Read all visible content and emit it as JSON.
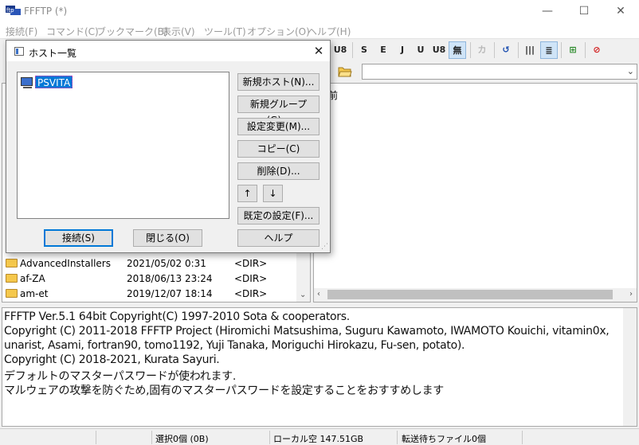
{
  "window": {
    "title": "FFFTP (*)"
  },
  "window_controls": {
    "minimize": "—",
    "maximize": "☐",
    "close": "✕"
  },
  "menu": [
    "接続(F)",
    "コマンド(C)",
    "ブックマーク(B)",
    "表示(V)",
    "ツール(T)",
    "オプション(O)",
    "ヘルプ(H)"
  ],
  "toolbar": {
    "buttons": [
      "U8",
      "S",
      "E",
      "J",
      "U",
      "U8",
      "無",
      "カ",
      "↺",
      "|||",
      "≣",
      "⊞",
      "⊘"
    ]
  },
  "right_pane": {
    "header_fragment": "前"
  },
  "left_files": [
    {
      "name": "AdvancedInstallers",
      "date": "2021/05/02  0:31",
      "size": "<DIR>"
    },
    {
      "name": "af-ZA",
      "date": "2018/06/13 23:24",
      "size": "<DIR>"
    },
    {
      "name": "am-et",
      "date": "2019/12/07 18:14",
      "size": "<DIR>"
    }
  ],
  "log": [
    "FFFTP Ver.5.1 64bit Copyright(C) 1997-2010 Sota & cooperators.",
    "Copyright (C) 2011-2018 FFFTP Project (Hiromichi Matsushima, Suguru Kawamoto, IWAMOTO Kouichi, vitamin0x,",
    "unarist, Asami, fortran90, tomo1192, Yuji Tanaka, Moriguchi Hirokazu, Fu-sen, potato).",
    "Copyright (C) 2018-2021, Kurata Sayuri.",
    "デフォルトのマスターパスワードが使われます.",
    "マルウェアの攻撃を防ぐため,固有のマスターパスワードを設定することをおすすめします"
  ],
  "status": {
    "selected": "選択0個 (0B)",
    "local_free": "ローカル空 147.51GB",
    "queue": "転送待ちファイル0個"
  },
  "dialog": {
    "title": "ホスト一覧",
    "hosts": [
      "PSVITA"
    ],
    "buttons": {
      "new_host": "新規ホスト(N)...",
      "new_group": "新規グループ(G)...",
      "edit": "設定変更(M)...",
      "copy": "コピー(C)",
      "delete": "削除(D)...",
      "up": "↑",
      "down": "↓",
      "default_settings": "既定の設定(F)...",
      "connect": "接続(S)",
      "close": "閉じる(O)",
      "help": "ヘルプ"
    }
  }
}
